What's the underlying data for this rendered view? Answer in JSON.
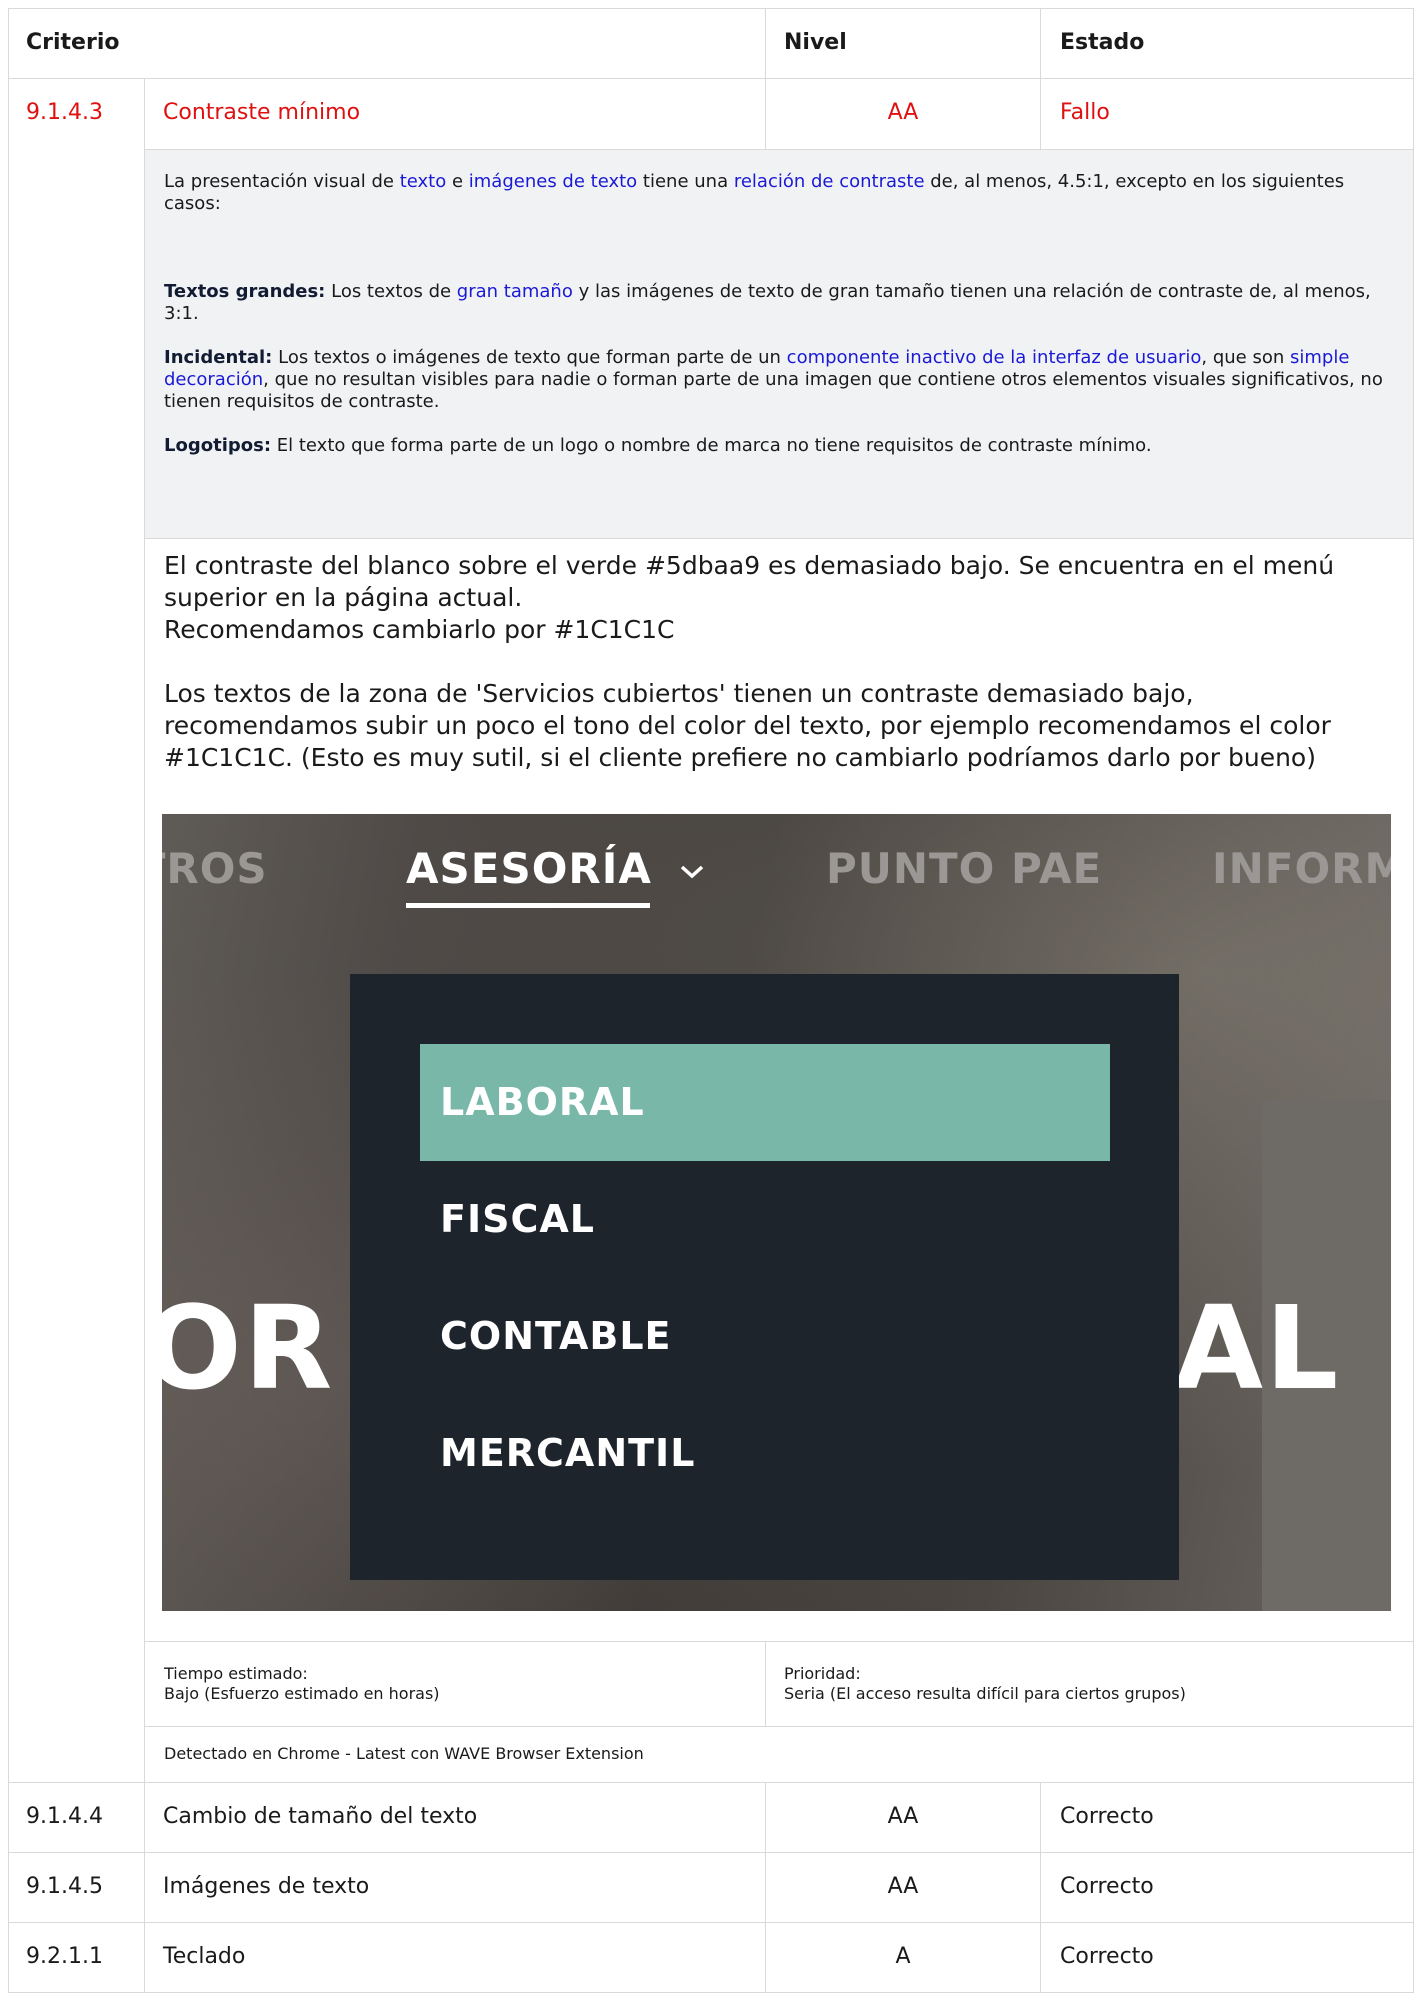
{
  "table": {
    "headers": {
      "criterio": "Criterio",
      "nivel": "Nivel",
      "estado": "Estado"
    },
    "highlighted_row": {
      "id": "9.1.4.3",
      "name": "Contraste mínimo",
      "level": "AA",
      "status": "Fallo",
      "definition": {
        "intro_pre": "La presentación visual de ",
        "link_texto": "texto",
        "intro_e": " e ",
        "link_imagenes": "imágenes de texto",
        "intro_mid": " tiene una ",
        "link_relacion": "relación de contraste",
        "intro_post": " de, al menos, 4.5:1, excepto en los siguientes casos:",
        "grandes_label": "Textos grandes:",
        "grandes_pre": " Los textos de ",
        "grandes_link": "gran tamaño",
        "grandes_post": " y las imágenes de texto de gran tamaño tienen una relación de contraste de, al menos, 3:1.",
        "incidental_label": "Incidental:",
        "incidental_pre": " Los textos o imágenes de texto que forman parte de un ",
        "incidental_link1": "componente inactivo de la interfaz de usuario",
        "incidental_mid": ", que son ",
        "incidental_link2": "simple decoración",
        "incidental_post": ", que no resultan visibles para nadie o forman parte de una imagen que contiene otros elementos visuales significativos, no tienen requisitos de contraste.",
        "logos_label": "Logotipos:",
        "logos_text": " El texto que forma parte de un logo o nombre de marca no tiene requisitos de contraste mínimo."
      },
      "comment": {
        "line1": "El contraste del blanco sobre el verde #5dbaa9 es demasiado bajo. Se encuentra en el menú superior en la página actual.",
        "line2": "Recomendamos cambiarlo por #1C1C1C",
        "para2": "Los textos de la zona de 'Servicios cubiertos' tienen un contraste demasiado bajo, recomendamos subir un poco el tono del color del texto, por ejemplo recomendamos el color #1C1C1C. (Esto es muy sutil, si el cliente prefiere no cambiarlo podríamos darlo por bueno)"
      },
      "screenshot": {
        "nav": [
          "OTROS",
          "ASESORÍA",
          "PUNTO PAE",
          "INFORM"
        ],
        "dropdown": [
          "LABORAL",
          "FISCAL",
          "CONTABLE",
          "MERCANTIL"
        ],
        "big_left": "OR",
        "big_right": "AL",
        "selected_color": "#79b7a9",
        "dropdown_bg": "#1e242c"
      },
      "tiempo_label": "Tiempo estimado:",
      "tiempo_value": "Bajo (Esfuerzo estimado en horas)",
      "prioridad_label": "Prioridad:",
      "prioridad_value": "Seria (El acceso resulta difícil para ciertos grupos)",
      "detected": "Detectado en Chrome - Latest con WAVE Browser Extension"
    },
    "rows": [
      {
        "id": "9.1.4.4",
        "name": "Cambio de tamaño del texto",
        "level": "AA",
        "status": "Correcto"
      },
      {
        "id": "9.1.4.5",
        "name": "Imágenes de texto",
        "level": "AA",
        "status": "Correcto"
      },
      {
        "id": "9.2.1.1",
        "name": "Teclado",
        "level": "A",
        "status": "Correcto"
      }
    ],
    "fail_color": "#e01010",
    "link_color": "#1a1ad6"
  }
}
